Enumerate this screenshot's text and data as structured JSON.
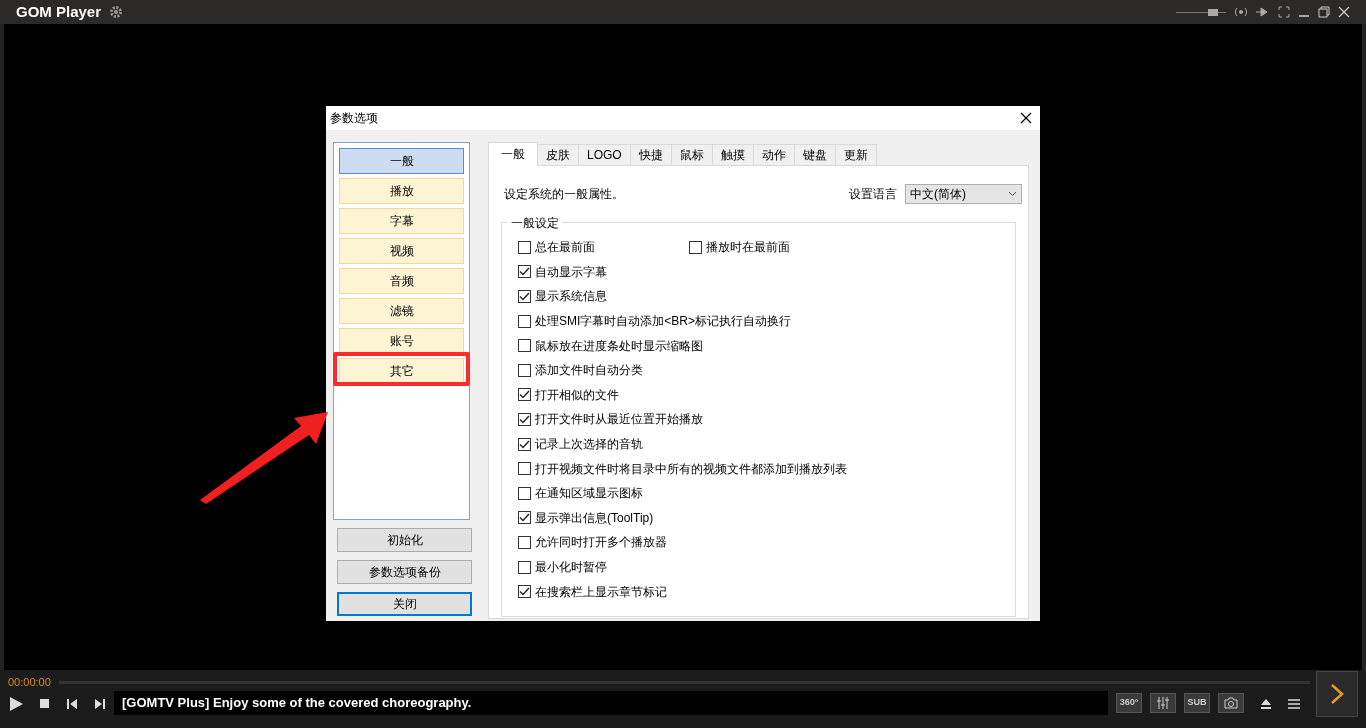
{
  "app": {
    "title": "GOM Player",
    "volume": {
      "level": 0.8
    }
  },
  "dialog": {
    "title": "参数选项",
    "sidebar": [
      {
        "label": "一般",
        "selected": true,
        "highlighted": false
      },
      {
        "label": "播放",
        "selected": false,
        "highlighted": false
      },
      {
        "label": "字幕",
        "selected": false,
        "highlighted": false
      },
      {
        "label": "视频",
        "selected": false,
        "highlighted": false
      },
      {
        "label": "音频",
        "selected": false,
        "highlighted": false
      },
      {
        "label": "滤镜",
        "selected": false,
        "highlighted": false
      },
      {
        "label": "账号",
        "selected": false,
        "highlighted": false
      },
      {
        "label": "其它",
        "selected": false,
        "highlighted": true
      }
    ],
    "side_buttons": [
      {
        "label": "初始化",
        "focused": false
      },
      {
        "label": "参数选项备份",
        "focused": false
      },
      {
        "label": "关闭",
        "focused": true
      }
    ],
    "tabs": [
      {
        "label": "一般",
        "selected": true
      },
      {
        "label": "皮肤",
        "selected": false
      },
      {
        "label": "LOGO",
        "selected": false
      },
      {
        "label": "快捷",
        "selected": false
      },
      {
        "label": "鼠标",
        "selected": false
      },
      {
        "label": "触摸",
        "selected": false
      },
      {
        "label": "动作",
        "selected": false
      },
      {
        "label": "键盘",
        "selected": false
      },
      {
        "label": "更新",
        "selected": false
      }
    ],
    "description": "设定系统的一般属性。",
    "language": {
      "label": "设置语言",
      "value": "中文(简体)"
    },
    "group": {
      "title": "一般设定",
      "rows": [
        [
          {
            "label": "总在最前面",
            "checked": false
          },
          {
            "label": "播放时在最前面",
            "checked": false
          }
        ],
        [
          {
            "label": "自动显示字幕",
            "checked": true
          }
        ],
        [
          {
            "label": "显示系统信息",
            "checked": true
          }
        ],
        [
          {
            "label": "处理SMI字幕时自动添加<BR>标记执行自动换行",
            "checked": false
          }
        ],
        [
          {
            "label": "鼠标放在进度条处时显示缩略图",
            "checked": false
          }
        ],
        [
          {
            "label": "添加文件时自动分类",
            "checked": false
          }
        ],
        [
          {
            "label": "打开相似的文件",
            "checked": true
          }
        ],
        [
          {
            "label": "打开文件时从最近位置开始播放",
            "checked": true
          }
        ],
        [
          {
            "label": "记录上次选择的音轨",
            "checked": true
          }
        ],
        [
          {
            "label": "打开视频文件时将目录中所有的视频文件都添加到播放列表",
            "checked": false
          }
        ],
        [
          {
            "label": "在通知区域显示图标",
            "checked": false
          }
        ],
        [
          {
            "label": "显示弹出信息(ToolTip)",
            "checked": true
          }
        ],
        [
          {
            "label": "允许同时打开多个播放器",
            "checked": false
          }
        ],
        [
          {
            "label": "最小化时暂停",
            "checked": false
          }
        ],
        [
          {
            "label": "在搜索栏上显示章节标记",
            "checked": true
          }
        ]
      ]
    }
  },
  "player": {
    "time": "00:00:00",
    "ticker": "[GOMTV Plus] Enjoy some of the covered choreography.",
    "button_360": "360°",
    "button_sub": "SUB"
  }
}
